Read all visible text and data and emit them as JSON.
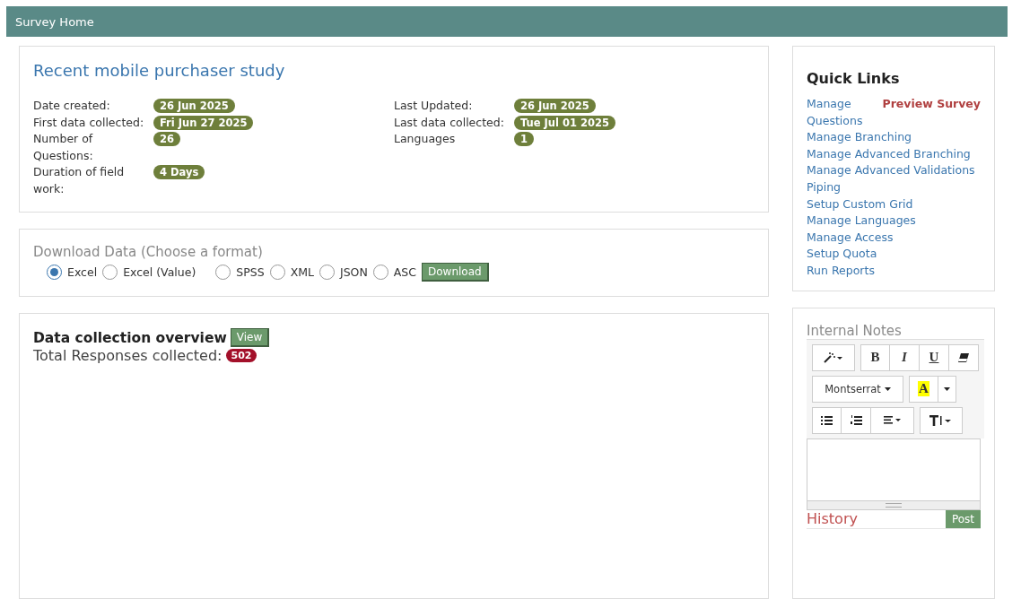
{
  "header": {
    "title": "Survey Home"
  },
  "survey": {
    "title": "Recent mobile purchaser study",
    "columns": [
      [
        {
          "label": "Date created:",
          "value": "26 Jun 2025"
        },
        {
          "label": "First data collected:",
          "value": "Fri Jun 27 2025"
        },
        {
          "label": "Number of Questions:",
          "value": "26"
        },
        {
          "label": "Duration of field work:",
          "value": "4 Days"
        }
      ],
      [
        {
          "label": "Last Updated:",
          "value": "26 Jun 2025"
        },
        {
          "label": "Last data collected:",
          "value": "Tue Jul 01 2025"
        },
        {
          "label": "Languages",
          "value": "1"
        }
      ]
    ]
  },
  "download": {
    "title": "Download Data (Choose a format)",
    "formats": [
      {
        "label": "Excel",
        "selected": true
      },
      {
        "label": "Excel (Value)",
        "selected": false
      },
      {
        "label": "SPSS",
        "selected": false
      },
      {
        "label": "XML",
        "selected": false
      },
      {
        "label": "JSON",
        "selected": false
      },
      {
        "label": "ASC",
        "selected": false
      }
    ],
    "button": "Download"
  },
  "overview": {
    "title": "Data collection overview",
    "view_button": "View",
    "total_label": "Total Responses collected:",
    "total_value": "502"
  },
  "quick_links": {
    "title": "Quick Links",
    "preview": "Preview Survey",
    "links": [
      "Manage Questions",
      "Manage Branching",
      "Manage Advanced Branching",
      "Manage Advanced Validations",
      "Piping",
      "Setup Custom Grid",
      "Manage Languages",
      "Manage Access",
      "Setup Quota",
      "Run Reports"
    ]
  },
  "notes": {
    "title": "Internal Notes",
    "bold": "B",
    "italic": "I",
    "underline": "U",
    "font": "Montserrat",
    "color_letter": "A",
    "history": "History",
    "post_button": "Post"
  }
}
